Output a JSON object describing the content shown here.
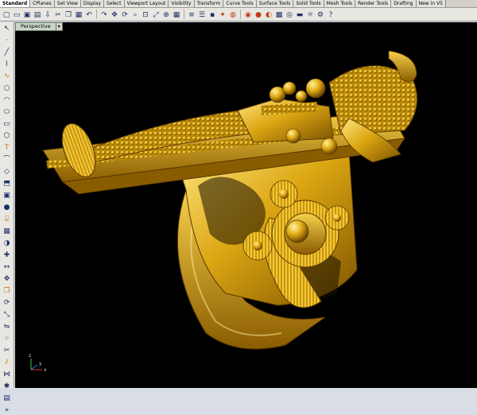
{
  "tabs": [
    {
      "label": "Standard",
      "active": true
    },
    {
      "label": "CPlanes"
    },
    {
      "label": "Set View"
    },
    {
      "label": "Display"
    },
    {
      "label": "Select"
    },
    {
      "label": "Viewport Layout"
    },
    {
      "label": "Visibility"
    },
    {
      "label": "Transform"
    },
    {
      "label": "Curve Tools"
    },
    {
      "label": "Surface Tools"
    },
    {
      "label": "Solid Tools"
    },
    {
      "label": "Mesh Tools"
    },
    {
      "label": "Render Tools"
    },
    {
      "label": "Drafting"
    },
    {
      "label": "New in V5"
    }
  ],
  "viewport": {
    "title": "Perspective",
    "dropdown_glyph": "▾"
  },
  "axes": {
    "x": "x",
    "y": "y",
    "z": "z"
  },
  "colors": {
    "model_gold": "#d6a30a",
    "background": "#000000",
    "accent": "#c8d6c8"
  },
  "toolbar_icons": [
    "new-icon",
    "open-icon",
    "save-icon",
    "print-icon",
    "import-icon",
    "cut-icon",
    "copy-icon",
    "paste-icon",
    "undo-icon",
    "redo-icon",
    "pan-icon",
    "rotate-icon",
    "zoom-icon",
    "zoom-window-icon",
    "zoom-extents-icon",
    "zoom-selected-icon",
    "grid-icon",
    "layer-icon",
    "properties-icon",
    "lock-icon",
    "light-icon",
    "material-icon",
    "render-icon",
    "sphere-icon",
    "color-icon",
    "texture-icon",
    "environment-icon",
    "ground-icon",
    "sun-icon",
    "options-icon",
    "help-icon"
  ],
  "left_icons": [
    "select-icon",
    "point-icon",
    "line-icon",
    "polyline-icon",
    "curve-icon",
    "circle-icon",
    "arc-icon",
    "ellipse-icon",
    "rectangle-icon",
    "polygon-icon",
    "text-icon",
    "fillet-icon",
    "surface-icon",
    "extrude-icon",
    "box-icon",
    "sphere-icon",
    "cylinder-icon",
    "mesh-icon",
    "boolean-icon",
    "analyze-icon",
    "dimension-icon",
    "move-icon",
    "copy-icon",
    "rotate-icon",
    "scale-icon",
    "mirror-icon",
    "array-icon",
    "trim-icon",
    "split-icon",
    "join-icon",
    "explode-icon",
    "group-icon",
    "more-icon"
  ]
}
